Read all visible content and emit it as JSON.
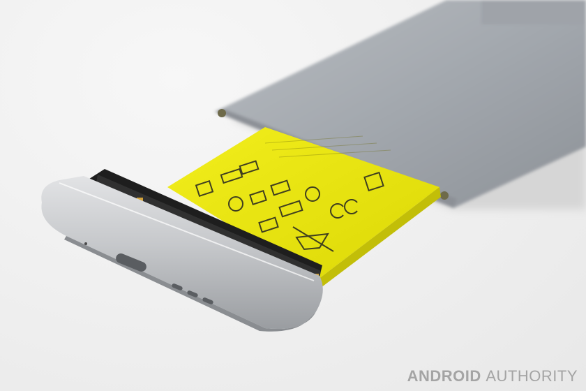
{
  "image": {
    "subject": "LG G5 phone with modular battery slot pulled out",
    "colors": {
      "background": "#f1f1f1",
      "phone_body": "#a9adb2",
      "battery_label": "#e8e60a",
      "module_cap": "#c4c6c9",
      "connector_black": "#1c1c1c"
    }
  },
  "watermark": {
    "word1": "ANDROID",
    "word2": "AUTHORITY"
  }
}
